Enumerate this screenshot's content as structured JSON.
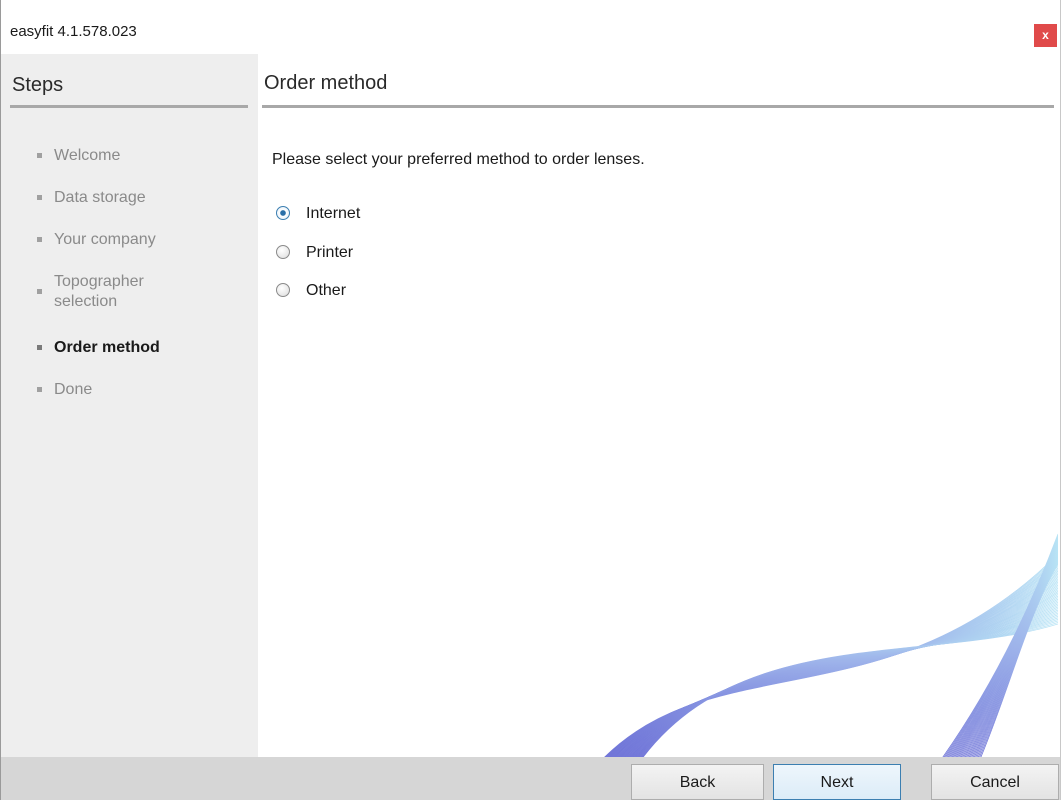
{
  "window": {
    "title": "easyfit 4.1.578.023",
    "close_label": "x"
  },
  "sidebar": {
    "title": "Steps",
    "items": [
      {
        "label": "Welcome",
        "active": false
      },
      {
        "label": "Data storage",
        "active": false
      },
      {
        "label": "Your company",
        "active": false
      },
      {
        "label": "Topographer selection",
        "active": false
      },
      {
        "label": "Order method",
        "active": true
      },
      {
        "label": "Done",
        "active": false
      }
    ]
  },
  "main": {
    "title": "Order method",
    "prompt": "Please select your preferred method to order lenses.",
    "options": [
      {
        "label": "Internet",
        "selected": true
      },
      {
        "label": "Printer",
        "selected": false
      },
      {
        "label": "Other",
        "selected": false
      }
    ]
  },
  "footer": {
    "back_label": "Back",
    "next_label": "Next",
    "cancel_label": "Cancel"
  },
  "colors": {
    "swirl_light": "#b8e4f5",
    "swirl_dark": "#6b6fd6",
    "close_bg": "#e04a4a"
  }
}
